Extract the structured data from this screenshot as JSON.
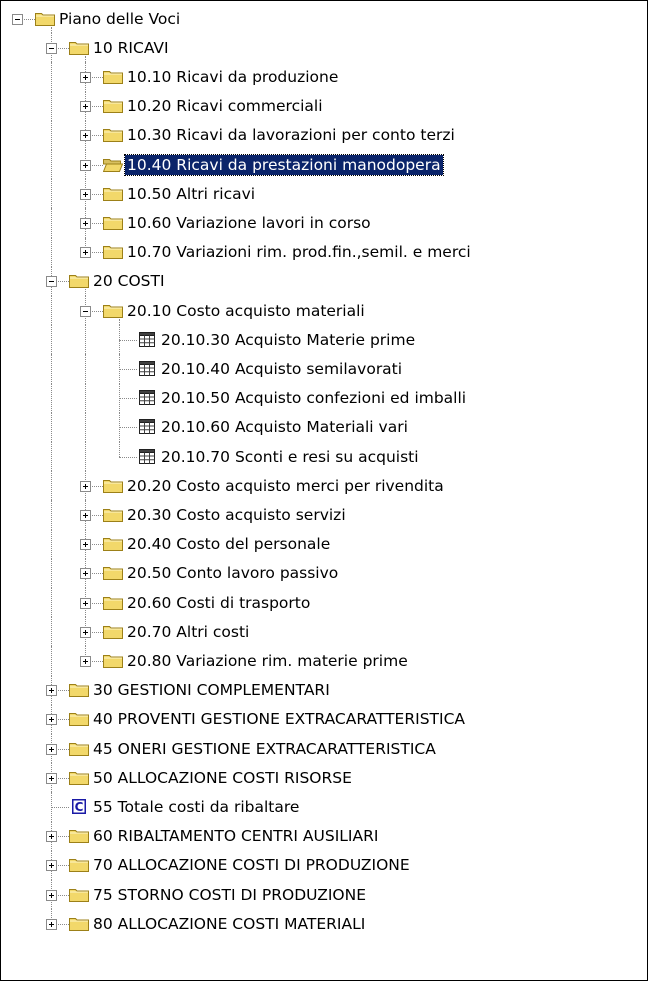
{
  "tree": {
    "nodes": [
      {
        "label": "Piano delle Voci",
        "level": 0,
        "icon": "folder-icon",
        "state": "expanded",
        "kind": "root"
      },
      {
        "label": "10 RICAVI",
        "level": 1,
        "icon": "folder-icon",
        "state": "expanded",
        "last": false
      },
      {
        "label": "10.10 Ricavi da produzione",
        "level": 2,
        "icon": "folder-icon",
        "state": "collapsed",
        "last": false
      },
      {
        "label": "10.20 Ricavi commerciali",
        "level": 2,
        "icon": "folder-icon",
        "state": "collapsed",
        "last": false
      },
      {
        "label": "10.30 Ricavi da lavorazioni per conto terzi",
        "level": 2,
        "icon": "folder-icon",
        "state": "collapsed",
        "last": false
      },
      {
        "label": "10.40 Ricavi da prestazioni manodopera",
        "level": 2,
        "icon": "folder-open-icon",
        "state": "collapsed",
        "last": false,
        "selected": true
      },
      {
        "label": "10.50 Altri ricavi",
        "level": 2,
        "icon": "folder-icon",
        "state": "collapsed",
        "last": false
      },
      {
        "label": "10.60 Variazione lavori in corso",
        "level": 2,
        "icon": "folder-icon",
        "state": "collapsed",
        "last": false
      },
      {
        "label": "10.70 Variazioni rim. prod.fin.,semil. e merci",
        "level": 2,
        "icon": "folder-icon",
        "state": "collapsed",
        "last": true
      },
      {
        "label": "20 COSTI",
        "level": 1,
        "icon": "folder-icon",
        "state": "expanded",
        "last": false
      },
      {
        "label": "20.10 Costo acquisto materiali",
        "level": 2,
        "icon": "folder-icon",
        "state": "expanded",
        "last": false
      },
      {
        "label": "20.10.30 Acquisto Materie prime",
        "level": 3,
        "icon": "table-icon",
        "state": "leaf",
        "last": false
      },
      {
        "label": "20.10.40 Acquisto semilavorati",
        "level": 3,
        "icon": "table-icon",
        "state": "leaf",
        "last": false
      },
      {
        "label": "20.10.50 Acquisto confezioni ed imballi",
        "level": 3,
        "icon": "table-icon",
        "state": "leaf",
        "last": false
      },
      {
        "label": "20.10.60 Acquisto Materiali vari",
        "level": 3,
        "icon": "table-icon",
        "state": "leaf",
        "last": false
      },
      {
        "label": "20.10.70 Sconti e resi su acquisti",
        "level": 3,
        "icon": "table-icon",
        "state": "leaf",
        "last": true
      },
      {
        "label": "20.20 Costo acquisto merci per rivendita",
        "level": 2,
        "icon": "folder-icon",
        "state": "collapsed",
        "last": false
      },
      {
        "label": "20.30 Costo acquisto servizi",
        "level": 2,
        "icon": "folder-icon",
        "state": "collapsed",
        "last": false
      },
      {
        "label": "20.40 Costo del personale",
        "level": 2,
        "icon": "folder-icon",
        "state": "collapsed",
        "last": false
      },
      {
        "label": "20.50 Conto lavoro passivo",
        "level": 2,
        "icon": "folder-icon",
        "state": "collapsed",
        "last": false
      },
      {
        "label": "20.60 Costi di trasporto",
        "level": 2,
        "icon": "folder-icon",
        "state": "collapsed",
        "last": false
      },
      {
        "label": "20.70 Altri costi",
        "level": 2,
        "icon": "folder-icon",
        "state": "collapsed",
        "last": false
      },
      {
        "label": "20.80 Variazione rim. materie prime",
        "level": 2,
        "icon": "folder-icon",
        "state": "collapsed",
        "last": true
      },
      {
        "label": "30 GESTIONI COMPLEMENTARI",
        "level": 1,
        "icon": "folder-icon",
        "state": "collapsed",
        "last": false
      },
      {
        "label": "40 PROVENTI GESTIONE EXTRACARATTERISTICA",
        "level": 1,
        "icon": "folder-icon",
        "state": "collapsed",
        "last": false
      },
      {
        "label": "45 ONERI GESTIONE EXTRACARATTERISTICA",
        "level": 1,
        "icon": "folder-icon",
        "state": "collapsed",
        "last": false
      },
      {
        "label": "50 ALLOCAZIONE COSTI RISORSE",
        "level": 1,
        "icon": "folder-icon",
        "state": "collapsed",
        "last": false
      },
      {
        "label": "55 Totale costi da ribaltare",
        "level": 1,
        "icon": "calc-icon",
        "state": "leaf",
        "last": false
      },
      {
        "label": "60 RIBALTAMENTO CENTRI AUSILIARI",
        "level": 1,
        "icon": "folder-icon",
        "state": "collapsed",
        "last": false
      },
      {
        "label": "70 ALLOCAZIONE COSTI DI PRODUZIONE",
        "level": 1,
        "icon": "folder-icon",
        "state": "collapsed",
        "last": false
      },
      {
        "label": "75 STORNO COSTI DI PRODUZIONE",
        "level": 1,
        "icon": "folder-icon",
        "state": "collapsed",
        "last": false
      },
      {
        "label": "80 ALLOCAZIONE COSTI MATERIALI",
        "level": 1,
        "icon": "folder-icon",
        "state": "collapsed",
        "last": true
      }
    ]
  },
  "colors": {
    "folder_fill": "#f2d86a",
    "folder_edge": "#9c8018",
    "selection_bg": "#0a246a",
    "selection_text": "#ffffff",
    "connector": "#8a8a8a",
    "calc_icon": "#1a1aa6"
  }
}
